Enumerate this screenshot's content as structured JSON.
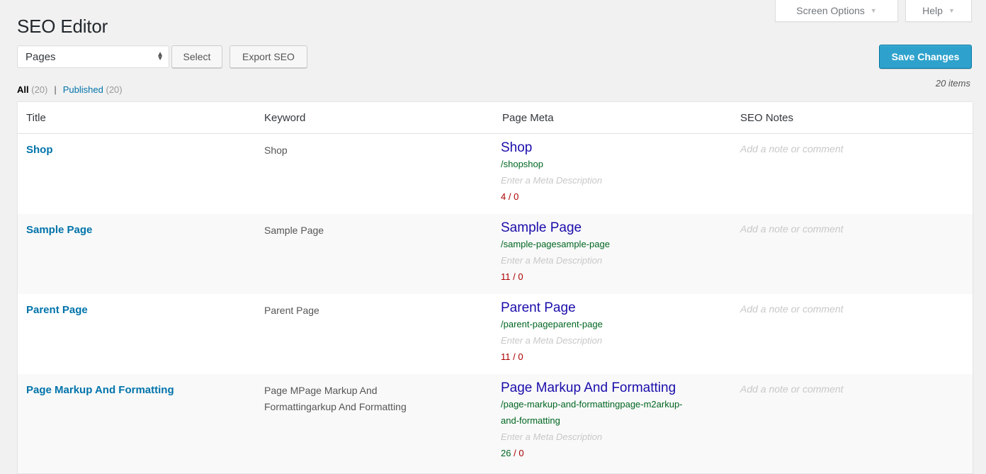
{
  "header": {
    "title": "SEO Editor",
    "screen_options_label": "Screen Options",
    "help_label": "Help",
    "dropdown_arrow": "▼"
  },
  "toolbar": {
    "post_type_select": {
      "value": "Pages",
      "arrow_icon": "up-down-arrows"
    },
    "select_button": "Select",
    "export_button": "Export SEO",
    "save_button": "Save Changes"
  },
  "filters": {
    "all_label": "All",
    "all_count": "(20)",
    "separator": "|",
    "published_label": "Published",
    "published_count": "(20)"
  },
  "items_count": "20 items",
  "colors": {
    "link": "#0073aa",
    "primary_button": "#2ea2cc",
    "meta_title": "#1a0dab",
    "meta_url": "#006621",
    "count_bad": "#aa0000",
    "count_good": "#006621"
  },
  "table": {
    "columns": [
      "Title",
      "Keyword",
      "Page Meta",
      "SEO Notes"
    ],
    "rows": [
      {
        "title": "Shop",
        "keyword": "Shop",
        "meta_title": "Shop",
        "meta_url": "/shopshop",
        "meta_description_placeholder": "Enter a Meta Description",
        "title_length": "4",
        "count_separator": " / ",
        "description_length": "0",
        "title_length_status": "bad",
        "note_placeholder": "Add a note or comment"
      },
      {
        "title": "Sample Page",
        "keyword": "Sample Page",
        "meta_title": "Sample Page",
        "meta_url": "/sample-pagesample-page",
        "meta_description_placeholder": "Enter a Meta Description",
        "title_length": "11",
        "count_separator": " / ",
        "description_length": "0",
        "title_length_status": "bad",
        "note_placeholder": "Add a note or comment"
      },
      {
        "title": "Parent Page",
        "keyword": "Parent Page",
        "meta_title": "Parent Page",
        "meta_url": "/parent-pageparent-page",
        "meta_description_placeholder": "Enter a Meta Description",
        "title_length": "11",
        "count_separator": " / ",
        "description_length": "0",
        "title_length_status": "bad",
        "note_placeholder": "Add a note or comment"
      },
      {
        "title": "Page Markup And Formatting",
        "keyword": "Page MPage Markup And Formattingarkup And Formatting",
        "meta_title": "Page Markup And Formatting",
        "meta_url": "/page-markup-and-formattingpage-m2arkup-and-formatting",
        "meta_description_placeholder": "Enter a Meta Description",
        "title_length": "26",
        "count_separator": " / ",
        "description_length": "0",
        "title_length_status": "good",
        "note_placeholder": "Add a note or comment"
      }
    ]
  }
}
